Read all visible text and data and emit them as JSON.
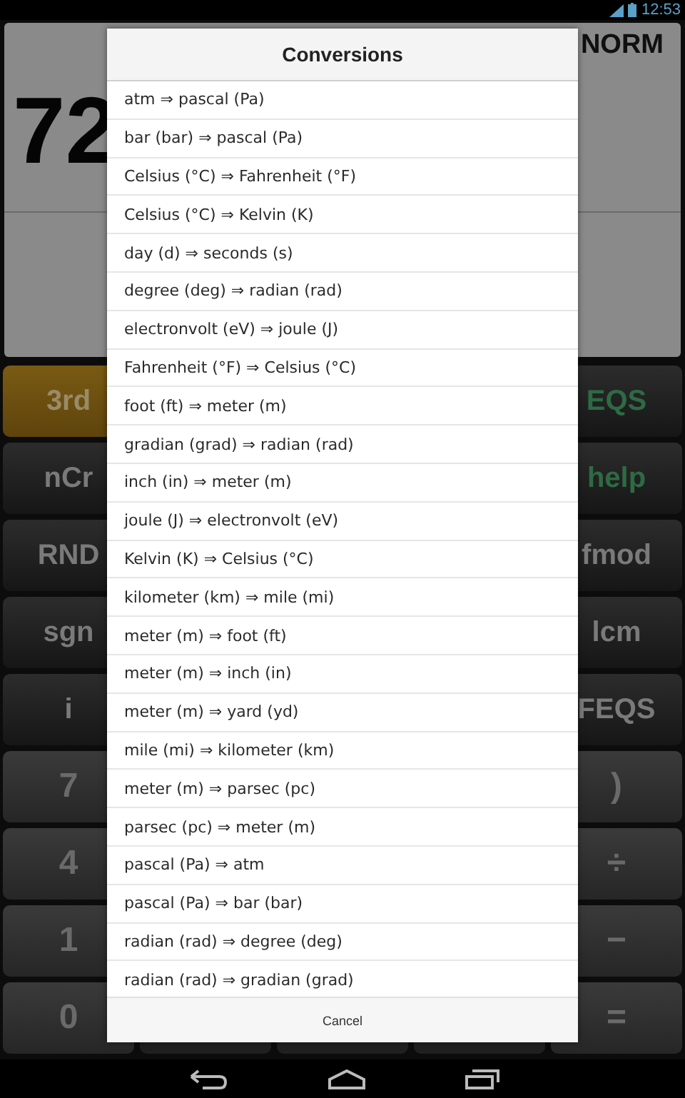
{
  "status_bar": {
    "time": "12:53"
  },
  "display": {
    "value": "72",
    "mode": "NORM"
  },
  "keys_left": [
    {
      "label": "3rd",
      "kind": "shift"
    },
    {
      "label": "nCr",
      "kind": "normal"
    },
    {
      "label": "RND",
      "kind": "normal"
    },
    {
      "label": "sgn",
      "kind": "normal"
    },
    {
      "label": "i",
      "kind": "normal"
    },
    {
      "label": "7",
      "kind": "digit"
    },
    {
      "label": "4",
      "kind": "digit"
    },
    {
      "label": "1",
      "kind": "digit"
    },
    {
      "label": "0",
      "kind": "digit"
    }
  ],
  "keys_right": [
    {
      "label": "EQS",
      "kind": "green"
    },
    {
      "label": "help",
      "kind": "green"
    },
    {
      "label": "fmod",
      "kind": "normal"
    },
    {
      "label": "lcm",
      "kind": "normal"
    },
    {
      "label": "FEQS",
      "kind": "normal"
    },
    {
      "label": ")",
      "kind": "digit"
    },
    {
      "label": "÷",
      "kind": "digit"
    },
    {
      "label": "−",
      "kind": "digit"
    },
    {
      "label": "=",
      "kind": "digit"
    }
  ],
  "dialog": {
    "title": "Conversions",
    "items": [
      "atm ⇒ pascal (Pa)",
      "bar (bar) ⇒ pascal (Pa)",
      "Celsius (°C) ⇒ Fahrenheit (°F)",
      "Celsius (°C) ⇒ Kelvin (K)",
      "day (d) ⇒ seconds (s)",
      "degree (deg) ⇒ radian (rad)",
      "electronvolt (eV) ⇒ joule (J)",
      "Fahrenheit (°F) ⇒ Celsius (°C)",
      "foot (ft) ⇒ meter (m)",
      "gradian (grad) ⇒ radian (rad)",
      "inch (in) ⇒ meter (m)",
      "joule (J) ⇒ electronvolt (eV)",
      "Kelvin (K) ⇒ Celsius (°C)",
      "kilometer (km) ⇒ mile (mi)",
      "meter (m) ⇒ foot (ft)",
      "meter (m) ⇒ inch (in)",
      "meter (m) ⇒ yard (yd)",
      "mile (mi) ⇒ kilometer (km)",
      "meter (m) ⇒ parsec (pc)",
      "parsec (pc) ⇒ meter (m)",
      "pascal (Pa) ⇒ atm",
      "pascal (Pa) ⇒ bar (bar)",
      "radian (rad) ⇒ degree (deg)",
      "radian (rad) ⇒ gradian (grad)"
    ],
    "cancel": "Cancel"
  }
}
